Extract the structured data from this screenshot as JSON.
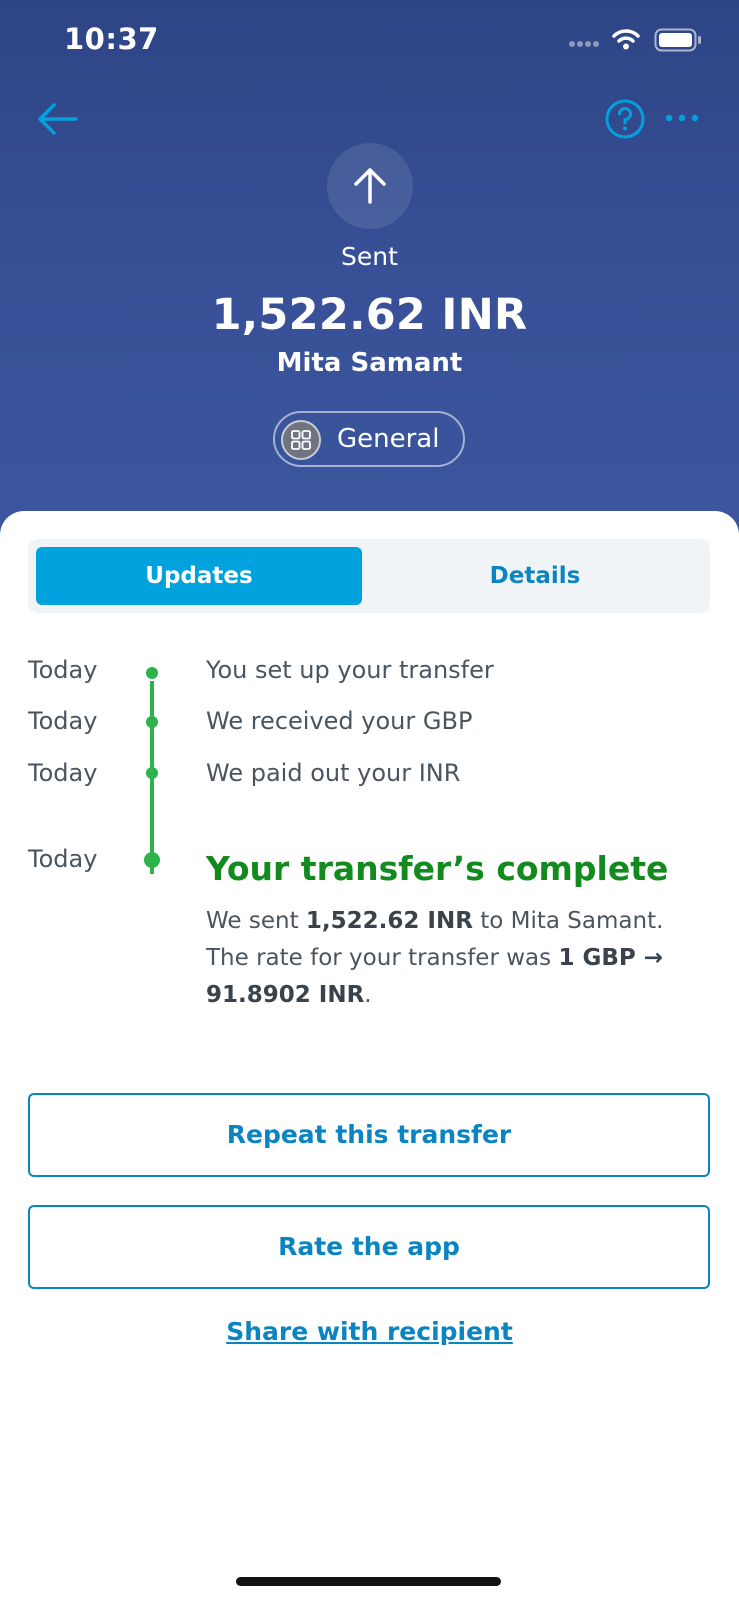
{
  "status_bar": {
    "time": "10:37"
  },
  "header": {
    "status": "Sent",
    "amount": "1,522.62 INR",
    "recipient": "Mita Samant",
    "category": "General"
  },
  "tabs": [
    {
      "label": "Updates",
      "selected": true
    },
    {
      "label": "Details",
      "selected": false
    }
  ],
  "timeline": [
    {
      "date": "Today",
      "text": "You set up your transfer"
    },
    {
      "date": "Today",
      "text": "We received your GBP"
    },
    {
      "date": "Today",
      "text": "We paid out your INR"
    }
  ],
  "complete": {
    "date": "Today",
    "title": "Your transfer’s complete",
    "desc_1": "We sent ",
    "desc_amount": "1,522.62 INR",
    "desc_2": " to Mita Samant. The rate for your transfer was ",
    "desc_rate": "1 GBP → 91.8902 INR",
    "desc_3": "."
  },
  "actions": {
    "repeat": "Repeat this transfer",
    "rate": "Rate the app",
    "share": "Share with recipient"
  },
  "colors": {
    "header_bg": "#374f95",
    "accent": "#00a2dd",
    "link": "#0b84c2",
    "success": "#2eb24b",
    "success_text": "#128a1d"
  },
  "icons": [
    "back-arrow-icon",
    "help-icon",
    "more-icon",
    "upload-arrow-icon",
    "grid-icon",
    "wifi-icon",
    "battery-icon",
    "signal-icon"
  ]
}
